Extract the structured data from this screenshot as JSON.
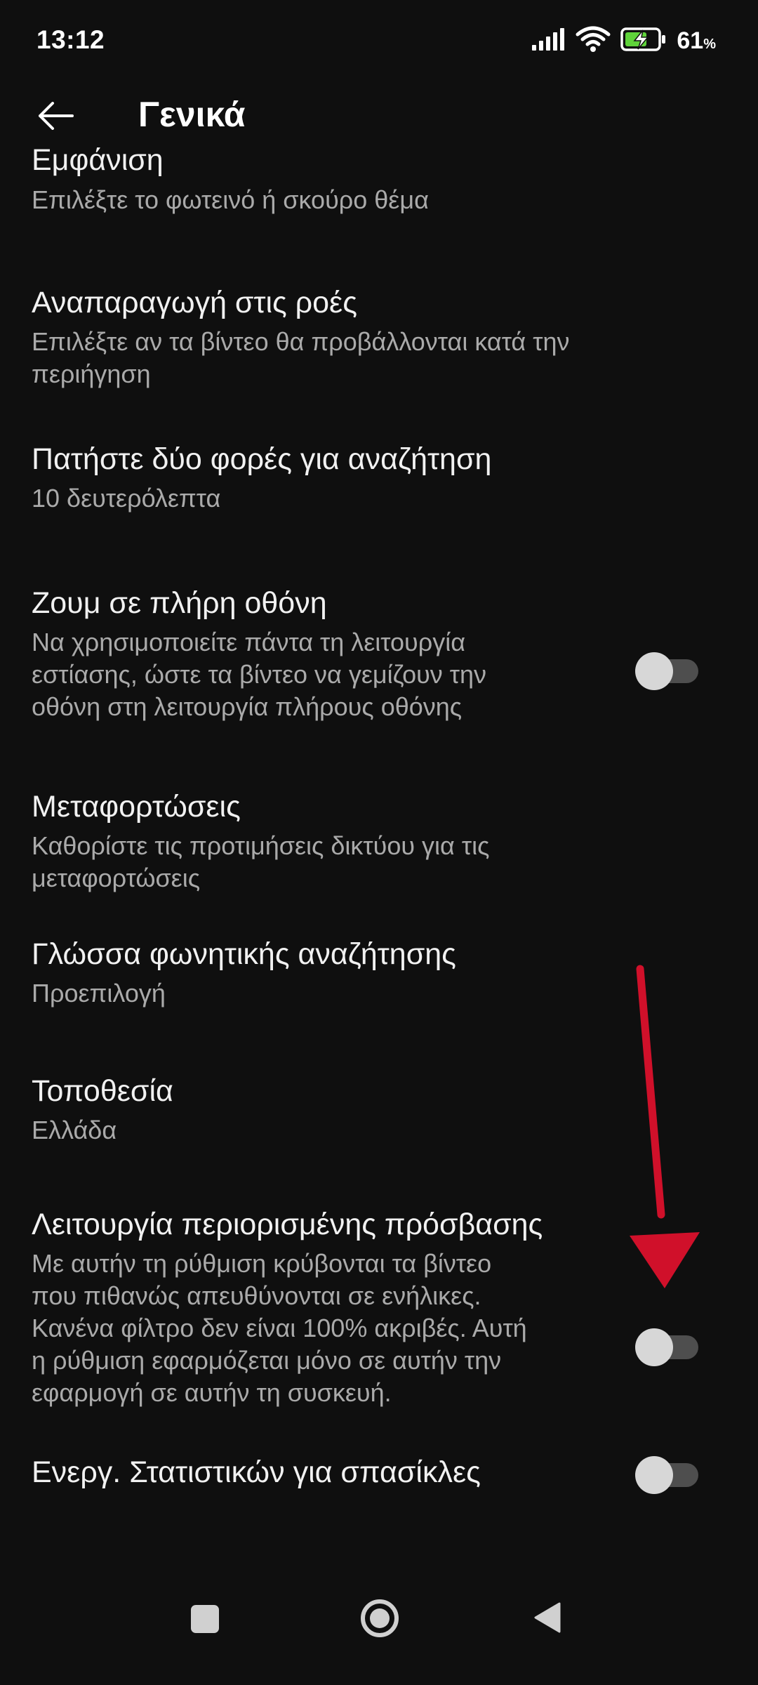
{
  "status_bar": {
    "time": "13:12",
    "battery_percent": "61",
    "battery_unit": "%",
    "icons": [
      "signal-icon",
      "wifi-icon",
      "battery-charging-icon"
    ]
  },
  "header": {
    "title": "Γενικά",
    "back_icon": "arrow-left-icon"
  },
  "settings": [
    {
      "title": "Εμφάνιση",
      "description": "Επιλέξτε το φωτεινό ή σκούρο θέμα"
    },
    {
      "title": "Αναπαραγωγή στις ροές",
      "description": "Επιλέξτε αν τα βίντεο θα προβάλλονται κατά την\nπεριήγηση"
    },
    {
      "title": "Πατήστε δύο φορές για αναζήτηση",
      "description": "10 δευτερόλεπτα"
    },
    {
      "title": "Ζουμ σε πλήρη οθόνη",
      "description": "Να χρησιμοποιείτε πάντα τη λειτουργία\nεστίασης, ώστε τα βίντεο να γεμίζουν την\nοθόνη στη λειτουργία πλήρους οθόνης",
      "toggle_on": false
    },
    {
      "title": "Μεταφορτώσεις",
      "description": "Καθορίστε τις προτιμήσεις δικτύου για τις\nμεταφορτώσεις"
    },
    {
      "title": "Γλώσσα φωνητικής αναζήτησης",
      "description": "Προεπιλογή"
    },
    {
      "title": "Τοποθεσία",
      "description": "Ελλάδα"
    },
    {
      "title": "Λειτουργία περιορισμένης πρόσβασης",
      "description": "Με αυτήν τη ρύθμιση κρύβονται τα βίντεο\nπου πιθανώς απευθύνονται σε ενήλικες.\nΚανένα φίλτρο δεν είναι 100% ακριβές. Αυτή\nη ρύθμιση εφαρμόζεται μόνο σε αυτήν την\nεφαρμογή σε αυτήν τη συσκευή.",
      "toggle_on": false
    },
    {
      "title": "Ενεργ. Στατιστικών για σπασίκλες",
      "toggle_on": false
    }
  ],
  "nav_bar": {
    "icons": [
      "recents-square-icon",
      "home-circle-icon",
      "back-triangle-icon"
    ]
  },
  "colors": {
    "background": "#0f0f0f",
    "primary_text": "#f1f1f1",
    "secondary_text": "#aaaaaa",
    "annotation_arrow": "#d0102a"
  }
}
